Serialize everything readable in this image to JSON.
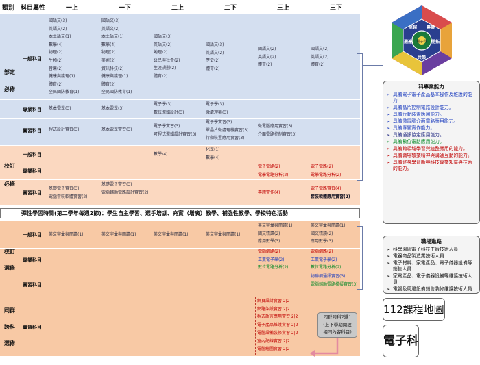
{
  "header": {
    "col_type": "類別",
    "col_attr": "科目屬性",
    "semesters": [
      "一上",
      "一下",
      "二上",
      "二下",
      "三上",
      "三下"
    ]
  },
  "sections": {
    "bd": [
      "部定",
      "必修"
    ],
    "xd": [
      "校訂",
      "必修"
    ],
    "xx": [
      "校訂",
      "選修"
    ],
    "tq": [
      "同群",
      "跨科",
      "選修"
    ]
  },
  "categories": {
    "general": "一般科目",
    "professional": "專業科目",
    "practical": "實習科目"
  },
  "bd_general": {
    "c1": [
      "國語文(3)",
      "英語文(2)",
      "本土語文(1)",
      "數學(4)",
      "物理(2)",
      "生物(2)",
      "音樂(2)",
      "健康與護理(1)",
      "體育(2)",
      "全民國防教育(1)"
    ],
    "c2": [
      "國語文(3)",
      "英語文(2)",
      "本土語文(1)",
      "數學(4)",
      "物理(2)",
      "美術(2)",
      "資訊科技(2)",
      "健康與護理(1)",
      "體育(2)",
      "全民國防教育(1)"
    ],
    "c3": [
      "國語文(3)",
      "英語文(2)",
      "地理(2)",
      "公民與社會(2)",
      "生涯規劃(2)",
      "體育(2)"
    ],
    "c4": [
      "國語文(3)",
      "英語文(2)",
      "歷史(2)",
      "體育(2)"
    ],
    "c5": [
      "國語文(2)",
      "英語文(2)",
      "體育(2)"
    ],
    "c6": [
      "國語文(2)",
      "英語文(2)",
      "體育(2)"
    ]
  },
  "bd_professional": {
    "c1": [
      "基本電學(3)"
    ],
    "c2": [
      "基本電學(3)"
    ],
    "c3": [
      "電子學(3)",
      "數位邏輯設計(3)"
    ],
    "c4": [
      "電子學(3)",
      "微處理機(3)"
    ]
  },
  "bd_practical": {
    "c1": [
      "程式設計實習(3)"
    ],
    "c2": [
      "基本電學實習(3)"
    ],
    "c3": [
      "電子學實習(3)",
      "可程式邏輯設計實習(3)"
    ],
    "c4": [
      "電子學實習(3)",
      "單晶片微處理機實習(3)",
      "行動裝置應用實習(3)"
    ],
    "c5": [
      "微電腦應用實習(3)",
      "介面電路控制實習(3)"
    ]
  },
  "xd_general": {
    "c3": [
      "數學(4)"
    ],
    "c4": [
      "化學(1)",
      "數學(4)"
    ]
  },
  "xd_professional": {
    "c5": [
      "電子電路(2)",
      "電學電路分析(2)"
    ],
    "c6": [
      "電子電路(2)",
      "電學電路分析(2)"
    ]
  },
  "xd_practical": {
    "c1": [
      "基礎電子實習(3)",
      "電腦套裝軟體實習(2)"
    ],
    "c2": [
      "基礎電子實習(3)",
      "電腦輔助電路設計實習(2)"
    ],
    "c5": [
      "專題實作(4)"
    ],
    "c6": [
      "電子電路實習(4)",
      "套裝軟體應用實習(2)"
    ]
  },
  "elective_banner": "彈性學習時間(第二學年每週2節)：學生自主學習、選手培訓、充實（增廣）教學、補強性教學、學校特色活動",
  "xx_general": {
    "c1": [
      "英文字彙與閱讀(1)"
    ],
    "c2": [
      "英文字彙與閱讀(1)"
    ],
    "c3": [
      "英文字彙與閱讀(1)"
    ],
    "c4": [
      "英文字彙與閱讀(1)"
    ],
    "c5": [
      "英文字彙與閱讀(1)",
      "國文精讀(2)",
      "應用數學(3)"
    ],
    "c6": [
      "英文字彙與閱讀(1)",
      "國文精讀(2)",
      "應用數學(3)"
    ]
  },
  "xx_professional": {
    "c5": [
      "電腦網路(2)",
      "工業電子學(2)",
      "數位電路分析(2)"
    ],
    "c6": [
      "電腦網路(2)",
      "工業電子學(2)",
      "數位電路分析(2)"
    ]
  },
  "xx_practical": {
    "c6": [
      "物聯網通訊實習(3)",
      "電腦輔助電路模擬實習(3)"
    ]
  },
  "tq_practical": [
    "網頁設計實習 2|2",
    "網路架設實習 2|2",
    "程式語言應用實習 2|2",
    "電子產品維護實習 2|2",
    "電腦設備裝修實習 2|2",
    "室內配線實習 2|2",
    "電腦繪圖實習 2|2"
  ],
  "tq_note": [
    "同群跨科7選1",
    "(上下學期開設",
    "相同內容科目)"
  ],
  "logo": {
    "center": "電子科",
    "words": [
      "專業",
      "開拓",
      "卓越",
      "通達",
      "共榮"
    ]
  },
  "abilities": {
    "title": "科專業能力",
    "items": [
      {
        "text": "具備電子電子產品基本操作及維護的能力",
        "color": "blue"
      },
      {
        "text": "具備晶片控制電路設計能力。",
        "color": "blue"
      },
      {
        "text": "具備行動裝置應用能力。",
        "color": "blue"
      },
      {
        "text": "具備微電腦介面電路應用能力。",
        "color": "blue"
      },
      {
        "text": "具備專題實作能力。",
        "color": "blue"
      },
      {
        "text": "具備通訊協定應用能力。",
        "color": "navy"
      },
      {
        "text": "具備數位電路應用能力。",
        "color": "green"
      },
      {
        "text": "具備跨領域學習與統整應用的能力。",
        "color": "red"
      },
      {
        "text": "具備職場敬業精神與溝通互動的能力。",
        "color": "red"
      },
      {
        "text": "具備終身學習新興科技專業知識與技術的能力。",
        "color": "red"
      }
    ]
  },
  "careers": {
    "title": "職場進路",
    "items": [
      "科學園區電子科技工廠技術人員",
      "電器商品製造業技術人員",
      "電子材料、家電產品、電子儀器設備等銷售人員",
      "家電產品、電子儀器設備等維護技術人員",
      "電腦及周邊設備銷售裝修維護技術人員"
    ]
  },
  "map_title": "112課程地圖",
  "dept_name": "電子科",
  "colors": {
    "blue_band": "#d4dff0",
    "orange_band": "#f8c9a5",
    "red_text": "#c00000",
    "green_text": "#0b8a2a",
    "blue_text": "#1f3fbf"
  }
}
